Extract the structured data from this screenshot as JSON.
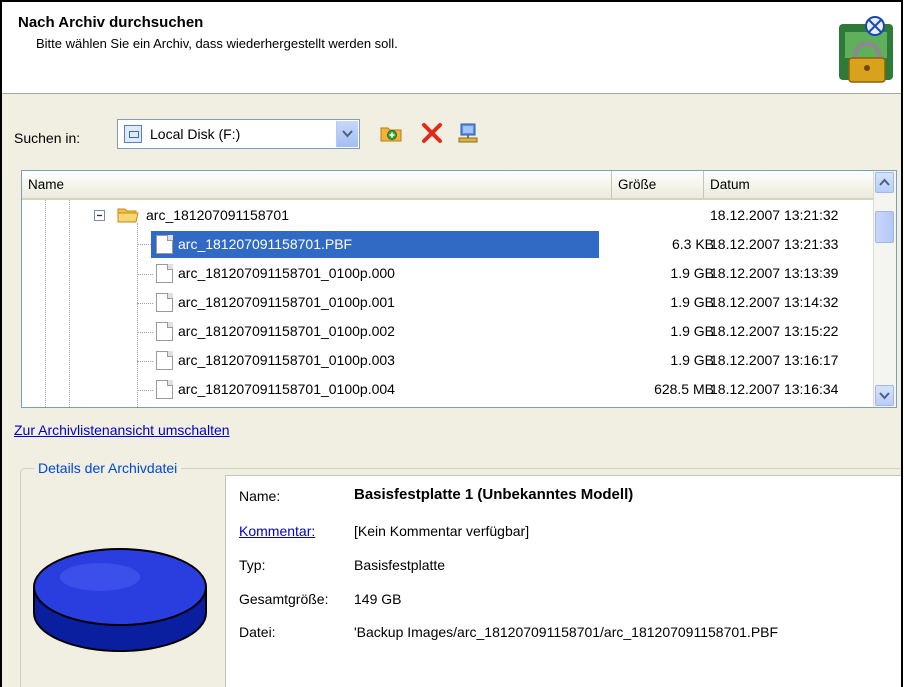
{
  "header": {
    "title": "Nach Archiv durchsuchen",
    "subtitle": "Bitte wählen Sie ein Archiv, dass wiederhergestellt werden soll."
  },
  "search": {
    "label": "Suchen in:",
    "location": "Local Disk (F:)"
  },
  "columns": {
    "name": "Name",
    "size": "Größe",
    "date": "Datum"
  },
  "tree": {
    "folder": {
      "name": "arc_181207091158701",
      "date": "18.12.2007 13:21:32"
    },
    "files": [
      {
        "name": "arc_181207091158701.PBF",
        "size": "6.3 KB",
        "date": "18.12.2007 13:21:33",
        "selected": true
      },
      {
        "name": "arc_181207091158701_0100p.000",
        "size": "1.9 GB",
        "date": "18.12.2007 13:13:39"
      },
      {
        "name": "arc_181207091158701_0100p.001",
        "size": "1.9 GB",
        "date": "18.12.2007 13:14:32"
      },
      {
        "name": "arc_181207091158701_0100p.002",
        "size": "1.9 GB",
        "date": "18.12.2007 13:15:22"
      },
      {
        "name": "arc_181207091158701_0100p.003",
        "size": "1.9 GB",
        "date": "18.12.2007 13:16:17"
      },
      {
        "name": "arc_181207091158701_0100p.004",
        "size": "628.5 MB",
        "date": "18.12.2007 13:16:34"
      }
    ]
  },
  "toggle_link": "Zur Archivlistenansicht umschalten",
  "details": {
    "group_title": "Details der Archivdatei",
    "name_label": "Name:",
    "name_value": "Basisfestplatte 1 (Unbekanntes Modell)",
    "comment_label": "Kommentar:",
    "comment_value": "[Kein Kommentar verfügbar]",
    "type_label": "Typ:",
    "type_value": "Basisfestplatte",
    "total_label": "Gesamtgröße:",
    "total_value": "149 GB",
    "file_label": "Datei:",
    "file_value": "'Backup Images/arc_181207091158701/arc_181207091158701.PBF"
  },
  "colors": {
    "selection": "#316ac5",
    "link": "#0000cc",
    "group_title": "#0046d5"
  }
}
